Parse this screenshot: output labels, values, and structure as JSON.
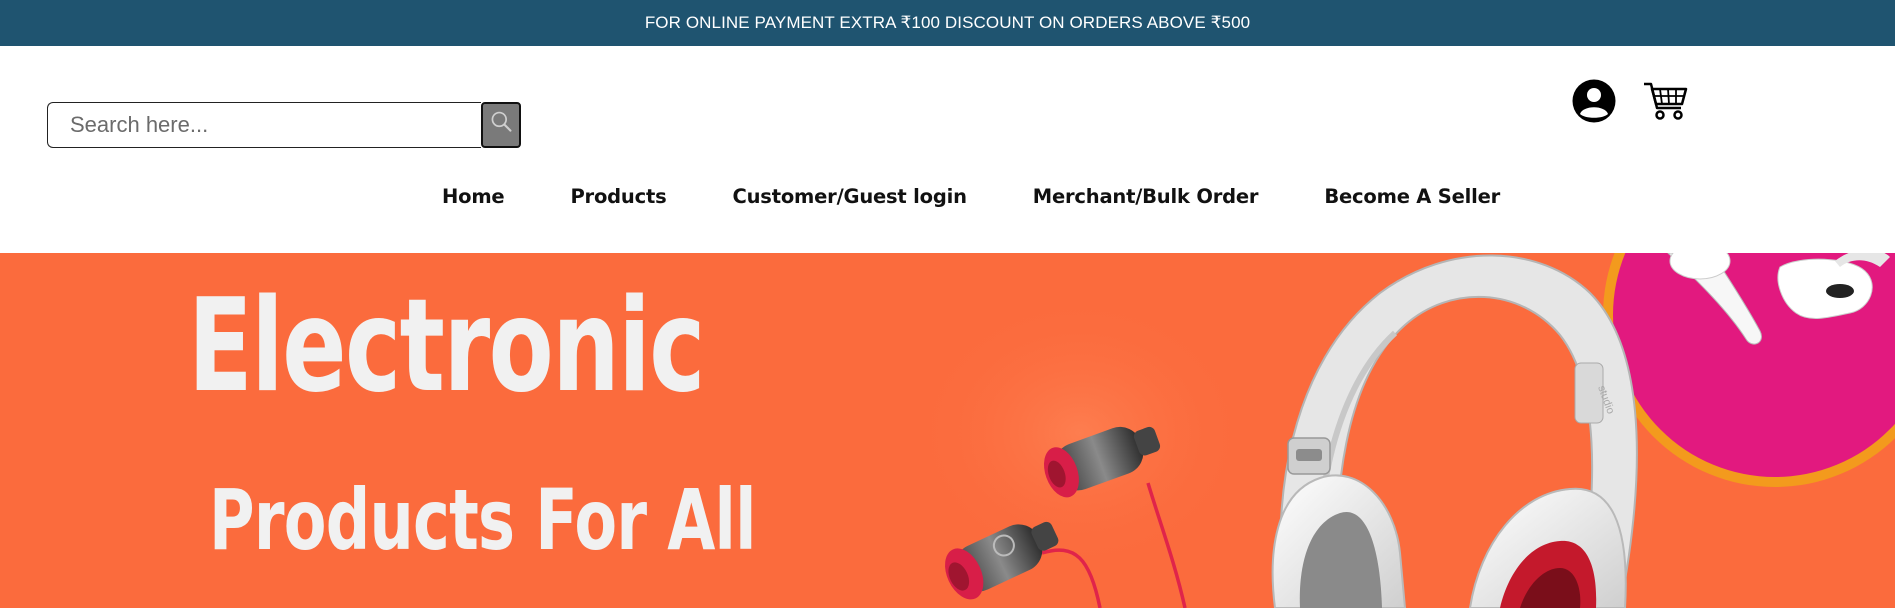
{
  "announcement": {
    "text": "FOR ONLINE PAYMENT EXTRA ₹100 DISCOUNT ON ORDERS ABOVE ₹500"
  },
  "search": {
    "placeholder": "Search here...",
    "value": "",
    "button_icon": "search-icon"
  },
  "header_icons": {
    "account_icon": "user-account-icon",
    "cart_icon": "shopping-cart-icon"
  },
  "nav": {
    "items": [
      {
        "label": "Home"
      },
      {
        "label": "Products"
      },
      {
        "label": "Customer/Guest login"
      },
      {
        "label": "Merchant/Bulk Order"
      },
      {
        "label": "Become A Seller"
      }
    ]
  },
  "banner": {
    "title": "Electronic",
    "subtitle": "Products For All",
    "background_color": "#fb6b3d",
    "headphone_brand": "studio"
  },
  "colors": {
    "announcement_bar": "#1f5470",
    "banner_orange": "#fb6b3d",
    "banner_pink_circle": "#e2197f",
    "banner_circle_border": "#f39a1d"
  }
}
